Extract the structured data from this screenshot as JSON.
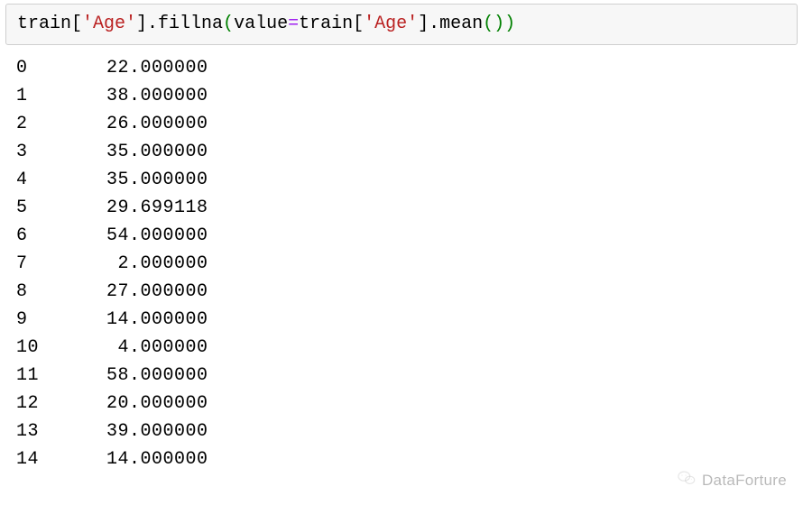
{
  "code": {
    "t1": "train[",
    "s1": "'Age'",
    "t2": "].fillna",
    "p1": "(",
    "t3": "value",
    "op": "=",
    "t4": "train[",
    "s2": "'Age'",
    "t5": "].mean",
    "p2": "())"
  },
  "output": {
    "rows": [
      {
        "index": "0",
        "value": "22.000000"
      },
      {
        "index": "1",
        "value": "38.000000"
      },
      {
        "index": "2",
        "value": "26.000000"
      },
      {
        "index": "3",
        "value": "35.000000"
      },
      {
        "index": "4",
        "value": "35.000000"
      },
      {
        "index": "5",
        "value": "29.699118"
      },
      {
        "index": "6",
        "value": "54.000000"
      },
      {
        "index": "7",
        "value": " 2.000000"
      },
      {
        "index": "8",
        "value": "27.000000"
      },
      {
        "index": "9",
        "value": "14.000000"
      },
      {
        "index": "10",
        "value": " 4.000000"
      },
      {
        "index": "11",
        "value": "58.000000"
      },
      {
        "index": "12",
        "value": "20.000000"
      },
      {
        "index": "13",
        "value": "39.000000"
      },
      {
        "index": "14",
        "value": "14.000000"
      }
    ]
  },
  "watermark": {
    "text": "DataForture"
  }
}
